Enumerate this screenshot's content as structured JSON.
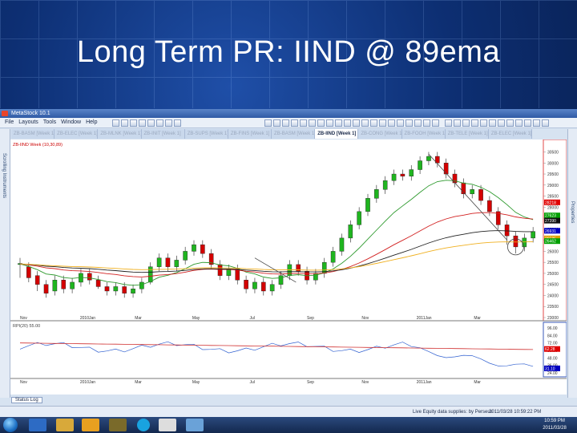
{
  "slide": {
    "title": "Long Term PR: IIND @ 89ema"
  },
  "app": {
    "title": "MetaStock 10.1",
    "menu": [
      "File",
      "Layouts",
      "Tools",
      "Window",
      "Help"
    ],
    "tabs": [
      "ZB-BASM [Week 1]",
      "ZB-ELEC [Week 1]",
      "ZB-MLNK [Week 1]",
      "ZB-INIT [Week 1]",
      "ZB-SUPS [Week 1]",
      "ZB-FINS [Week 1]",
      "ZB-BASM [Week 1]",
      "ZB-IIND [Week 1]",
      "ZB-CONG [Week 1]",
      "ZB-FOOH [Week 1]",
      "ZB-TELE [Week 1]",
      "ZB-ELEC [Week 1]"
    ],
    "active_tab_index": 7,
    "chart_label": "ZB-IIND Week (10,30,89)",
    "bottom_tab": "Status Log",
    "side_left": "Scrolling Instruments",
    "side_right": "Properties",
    "status_text": "Live Equity data supplies: by Perseus",
    "status_time": "2011/03/28 10:59:22 PM",
    "tray_time": "10:59 PM",
    "tray_date": "2011/03/28"
  },
  "chart_data": {
    "type": "candlestick",
    "x_labels": [
      "Nov",
      "2010Jan",
      "Mar",
      "May",
      "Jul",
      "Sep",
      "Nov",
      "2011Jan",
      "Mar"
    ],
    "price_ticks": [
      "30500",
      "30000",
      "29500",
      "29000",
      "28500",
      "28000",
      "27500",
      "27000",
      "26500",
      "26000",
      "25500",
      "25000",
      "24500",
      "24000",
      "23500",
      "23000"
    ],
    "price_range": [
      23000,
      30700
    ],
    "price_markers": [
      {
        "label": "28218",
        "value": 28218,
        "color": "#e00000"
      },
      {
        "label": "27623",
        "value": 27623,
        "color": "#00a000"
      },
      {
        "label": "27390",
        "value": 27390,
        "color": "#101010"
      },
      {
        "label": "26931",
        "value": 26931,
        "color": "#0000c0"
      },
      {
        "label": "26585",
        "value": 26585,
        "color": "#e0a000"
      },
      {
        "label": "26462",
        "value": 26462,
        "color": "#00a000"
      }
    ],
    "candles": [
      [
        25400,
        25450,
        24800,
        25700
      ],
      [
        25300,
        24800,
        24600,
        25500
      ],
      [
        24900,
        24500,
        24200,
        25100
      ],
      [
        24500,
        24100,
        23900,
        24700
      ],
      [
        24200,
        24700,
        24000,
        24900
      ],
      [
        24700,
        24300,
        24100,
        24900
      ],
      [
        24300,
        24600,
        24100,
        24800
      ],
      [
        24600,
        25000,
        24400,
        25200
      ],
      [
        25000,
        24700,
        24500,
        25200
      ],
      [
        24700,
        24400,
        24300,
        24900
      ],
      [
        24400,
        24200,
        24000,
        24600
      ],
      [
        24200,
        24400,
        24000,
        24600
      ],
      [
        24400,
        24100,
        23900,
        24600
      ],
      [
        24100,
        24300,
        23900,
        24500
      ],
      [
        24300,
        24600,
        24100,
        24800
      ],
      [
        24600,
        25300,
        24500,
        25500
      ],
      [
        25300,
        25700,
        25100,
        25900
      ],
      [
        25700,
        25300,
        25100,
        25900
      ],
      [
        25300,
        25600,
        25100,
        25800
      ],
      [
        25600,
        26000,
        25400,
        26200
      ],
      [
        26000,
        26300,
        25800,
        26500
      ],
      [
        26300,
        25900,
        25700,
        26500
      ],
      [
        25900,
        25400,
        25200,
        26100
      ],
      [
        25400,
        24900,
        24700,
        25600
      ],
      [
        24900,
        25200,
        24700,
        25400
      ],
      [
        25200,
        24700,
        24500,
        25400
      ],
      [
        24700,
        24300,
        24100,
        24900
      ],
      [
        24300,
        24600,
        24100,
        24800
      ],
      [
        24600,
        24200,
        24000,
        24800
      ],
      [
        24200,
        24500,
        24000,
        24700
      ],
      [
        24500,
        24900,
        24300,
        25100
      ],
      [
        24900,
        25400,
        24700,
        25600
      ],
      [
        25400,
        25100,
        24900,
        25600
      ],
      [
        25100,
        24700,
        24500,
        25300
      ],
      [
        24700,
        25000,
        24500,
        25200
      ],
      [
        25000,
        25500,
        24800,
        25700
      ],
      [
        25500,
        26000,
        25300,
        26200
      ],
      [
        26000,
        26600,
        25800,
        26800
      ],
      [
        26600,
        27200,
        26400,
        27400
      ],
      [
        27200,
        27800,
        27000,
        28000
      ],
      [
        27800,
        28400,
        27600,
        28600
      ],
      [
        28400,
        28800,
        28200,
        29000
      ],
      [
        28800,
        29200,
        28600,
        29400
      ],
      [
        29200,
        29500,
        29000,
        29700
      ],
      [
        29500,
        29400,
        29200,
        29700
      ],
      [
        29400,
        29700,
        29200,
        29900
      ],
      [
        29700,
        30100,
        29500,
        30300
      ],
      [
        30100,
        30300,
        29900,
        30500
      ],
      [
        30300,
        30000,
        29800,
        30500
      ],
      [
        30000,
        29500,
        29300,
        30200
      ],
      [
        29500,
        29100,
        28900,
        29700
      ],
      [
        29100,
        28600,
        28400,
        29300
      ],
      [
        28600,
        28800,
        28400,
        29000
      ],
      [
        28800,
        28300,
        28100,
        29000
      ],
      [
        28300,
        27800,
        27600,
        28500
      ],
      [
        27800,
        27200,
        27000,
        28000
      ],
      [
        27200,
        26700,
        26300,
        27400
      ],
      [
        26700,
        26200,
        25900,
        26900
      ],
      [
        26200,
        26600,
        26000,
        26800
      ],
      [
        26600,
        26900,
        26400,
        27100
      ]
    ],
    "indicator": {
      "label": "RPI(20) 55.00",
      "ticks": [
        "96.00",
        "84.00",
        "72.00",
        "60.00",
        "48.00",
        "36.00",
        "24.00",
        "12.00"
      ],
      "range": [
        20,
        100
      ],
      "markers": [
        {
          "label": "62.28",
          "value": 62.28,
          "color": "#e00000"
        },
        {
          "label": "31.10",
          "value": 31.1,
          "color": "#0000c0"
        }
      ]
    }
  }
}
